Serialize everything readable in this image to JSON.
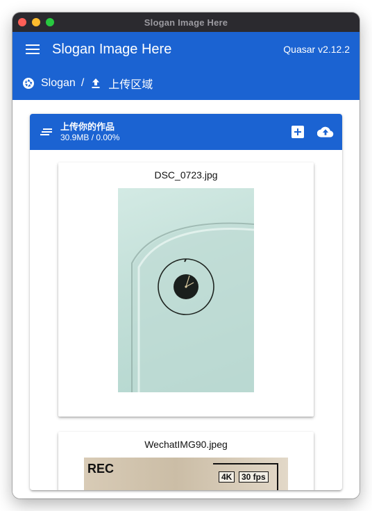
{
  "window": {
    "title": "Slogan Image Here"
  },
  "header": {
    "title": "Slogan Image Here",
    "version": "Quasar v2.12.2"
  },
  "breadcrumbs": [
    {
      "label": "Slogan",
      "icon": "camera-aperture-icon"
    },
    {
      "label": "上传区域",
      "icon": "upload-icon"
    }
  ],
  "breadcrumb_separator": "/",
  "uploader": {
    "title": "上传你的作品",
    "subtitle": "30.9MB / 0.00%",
    "files": [
      {
        "name": "DSC_0723.jpg"
      },
      {
        "name": "WechatIMG90.jpeg",
        "overlay": {
          "rec": "REC",
          "resolution": "4K",
          "fps": "30 fps"
        }
      }
    ]
  },
  "colors": {
    "primary": "#1b63d2",
    "titlebar": "#2b2a2f"
  }
}
